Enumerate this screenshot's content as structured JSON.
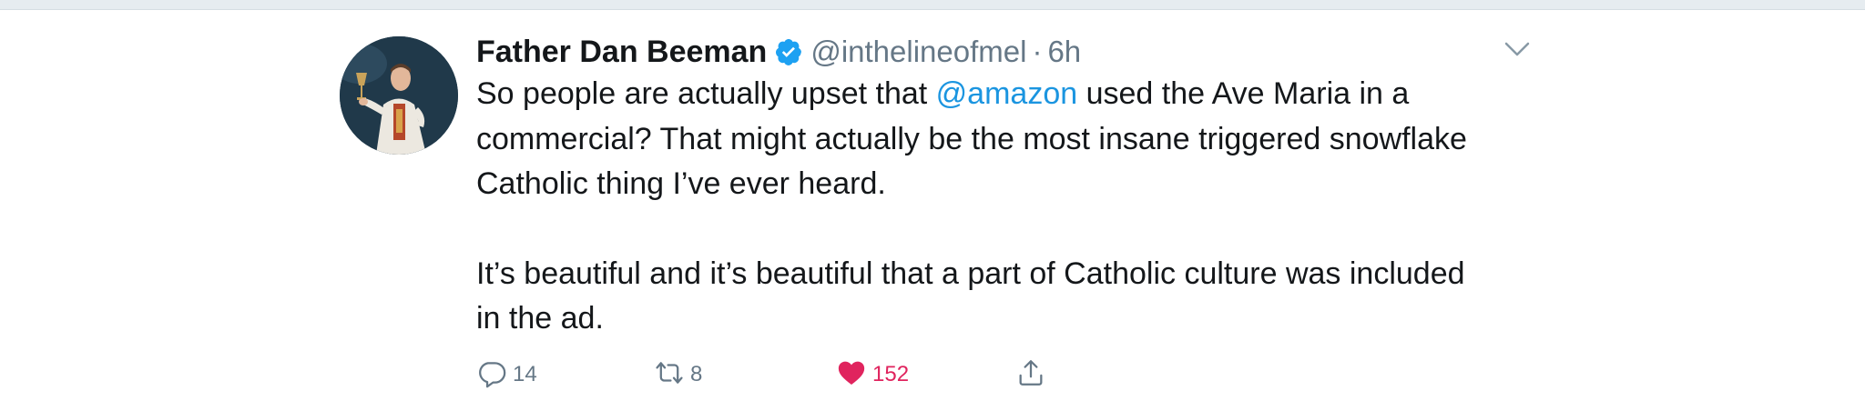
{
  "tweet": {
    "display_name": "Father Dan Beeman",
    "handle": "@inthelineofmel",
    "separator": "·",
    "time": "6h",
    "text": {
      "line1_before": "So people are actually upset that ",
      "mention": "@amazon",
      "line1_after": " used the Ave Maria in a commercial?  That might actually be the most insane triggered snowflake Catholic thing I’ve ever heard.",
      "para2": "It’s beautiful and it’s beautiful that a part of Catholic culture was included in the ad."
    },
    "actions": {
      "replies": "14",
      "retweets": "8",
      "likes": "152"
    }
  },
  "icons": {
    "verified": "verified-badge-icon",
    "caret": "chevron-down-icon",
    "reply": "reply-bubble-icon",
    "retweet": "retweet-icon",
    "like": "heart-icon",
    "share": "share-icon"
  },
  "colors": {
    "accent": "#1b95e0",
    "like": "#e0245e",
    "secondary_text": "#657786",
    "text": "#14171a"
  }
}
